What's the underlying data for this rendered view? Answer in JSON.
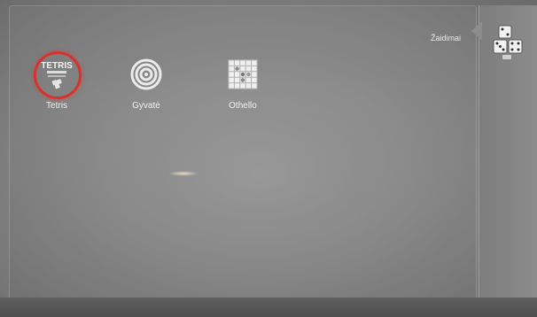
{
  "category": {
    "title": "Žaidimai",
    "icon": "dice-icon"
  },
  "games": [
    {
      "label": "Tetris",
      "icon": "tetris-icon",
      "selected": true,
      "logo_text": "TETRIS"
    },
    {
      "label": "Gyvatė",
      "icon": "target-icon",
      "selected": false
    },
    {
      "label": "Othello",
      "icon": "board-grid-icon",
      "selected": false
    }
  ],
  "colors": {
    "selection_ring": "#d8322f",
    "label_text": "#f0f0f0",
    "background": "#8a8a8a"
  }
}
